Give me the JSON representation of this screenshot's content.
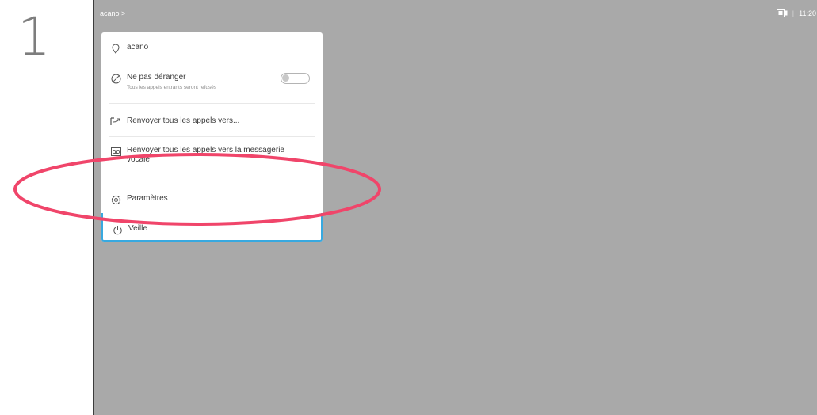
{
  "step": {
    "number": "1"
  },
  "topbar": {
    "title": "acano >",
    "time": "11:20",
    "separator": "|",
    "camera_icon": "camera-icon"
  },
  "menu": {
    "items": [
      {
        "id": "location",
        "label": "acano",
        "icon": "pin-icon"
      },
      {
        "id": "dnd",
        "label": "Ne pas déranger",
        "sublabel": "Tous les appels entrants seront refusés",
        "icon": "no-entry-icon",
        "toggle_on": false
      },
      {
        "id": "forward-all",
        "label": "Renvoyer tous les appels vers...",
        "icon": "forward-call-icon"
      },
      {
        "id": "forward-voicemail",
        "label": "Renvoyer tous les appels vers la messagerie vocale",
        "icon": "voicemail-icon"
      },
      {
        "id": "settings",
        "label": "Paramètres",
        "icon": "gear-icon"
      },
      {
        "id": "standby",
        "label": "Veille",
        "icon": "power-icon",
        "focused": true
      }
    ]
  },
  "colors": {
    "screen_bg": "#a9a9a9",
    "focus_border": "#38a9e0",
    "highlight_ring": "#f0456a",
    "step_number": "#7d7d7d"
  }
}
